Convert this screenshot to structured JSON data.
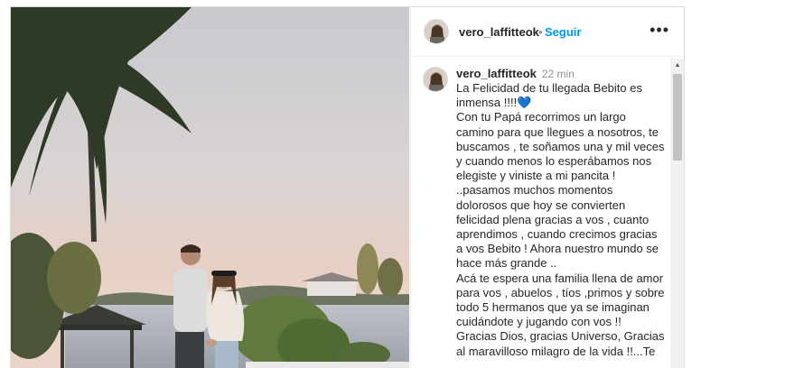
{
  "post": {
    "username": "vero_laffitteok",
    "separator": "•",
    "follow_label": "Seguir",
    "more_icon": "more-options-icon",
    "more_glyph": "•••"
  },
  "comment": {
    "username": "vero_laffitteok",
    "time": "22 min",
    "lines": [
      "La Felicidad de tu llegada Bebito es inmensa !!!!",
      "Con tu Papá recorrimos un largo camino para que llegues a nosotros, te buscamos , te soñamos una y mil veces y cuando menos lo esperábamos nos elegiste y viniste a mi pancita !",
      "..pasamos muchos momentos dolorosos que hoy se convierten felicidad plena gracias a vos , cuanto aprendimos , cuando crecimos gracias a vos Bebito ! Ahora nuestro mundo se hace más grande ..",
      "Acá te espera una familia llena de amor para vos , abuelos , tíos ,primos y sobre todo 5 hermanos que ya se imaginan cuidándote y jugando con vos !!",
      "Gracias Dios, gracias Universo, Gracias al maravilloso milagro de la vida !!...Te"
    ],
    "heart": "💙"
  },
  "colors": {
    "accent": "#0095f6",
    "muted": "#8e8e8e",
    "text": "#262626",
    "heart": "#1f5fd6"
  }
}
